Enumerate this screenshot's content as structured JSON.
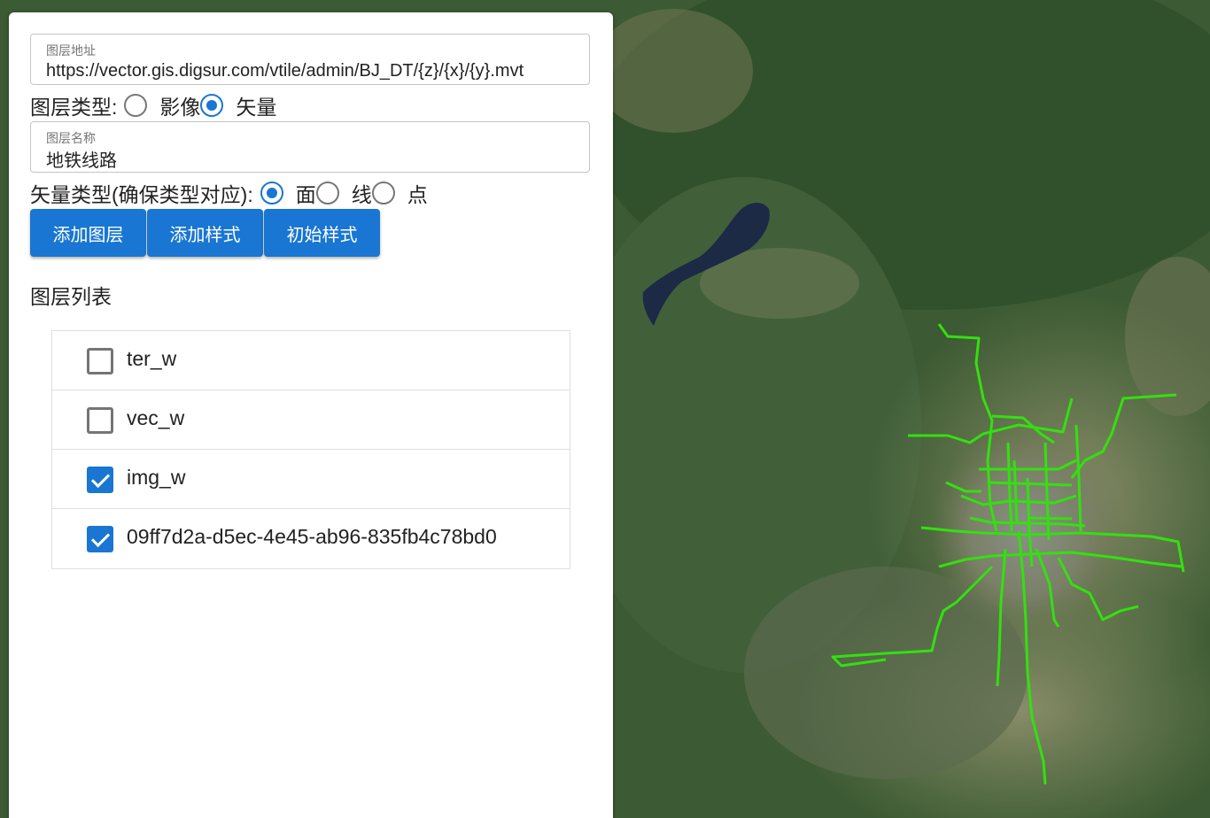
{
  "form": {
    "url_label": "图层地址",
    "url_value": "https://vector.gis.digsur.com/vtile/admin/BJ_DT/{z}/{x}/{y}.mvt",
    "layer_type_label": "图层类型:",
    "layer_type_options": [
      "影像",
      "矢量"
    ],
    "layer_type_selected": "矢量",
    "name_label": "图层名称",
    "name_value": "地铁线路",
    "vector_type_label": "矢量类型(确保类型对应):",
    "vector_type_options": [
      "面",
      "线",
      "点"
    ],
    "vector_type_selected": "面"
  },
  "buttons": {
    "add_layer": "添加图层",
    "add_style": "添加样式",
    "init_style": "初始样式"
  },
  "layers": {
    "title": "图层列表",
    "items": [
      {
        "name": "ter_w",
        "checked": false
      },
      {
        "name": "vec_w",
        "checked": false
      },
      {
        "name": "img_w",
        "checked": true
      },
      {
        "name": "09ff7d2a-d5ec-4e45-ab96-835fb4c78bd0",
        "checked": true
      }
    ]
  },
  "map": {
    "basemap": "satellite imagery",
    "line_color": "#33e010"
  }
}
